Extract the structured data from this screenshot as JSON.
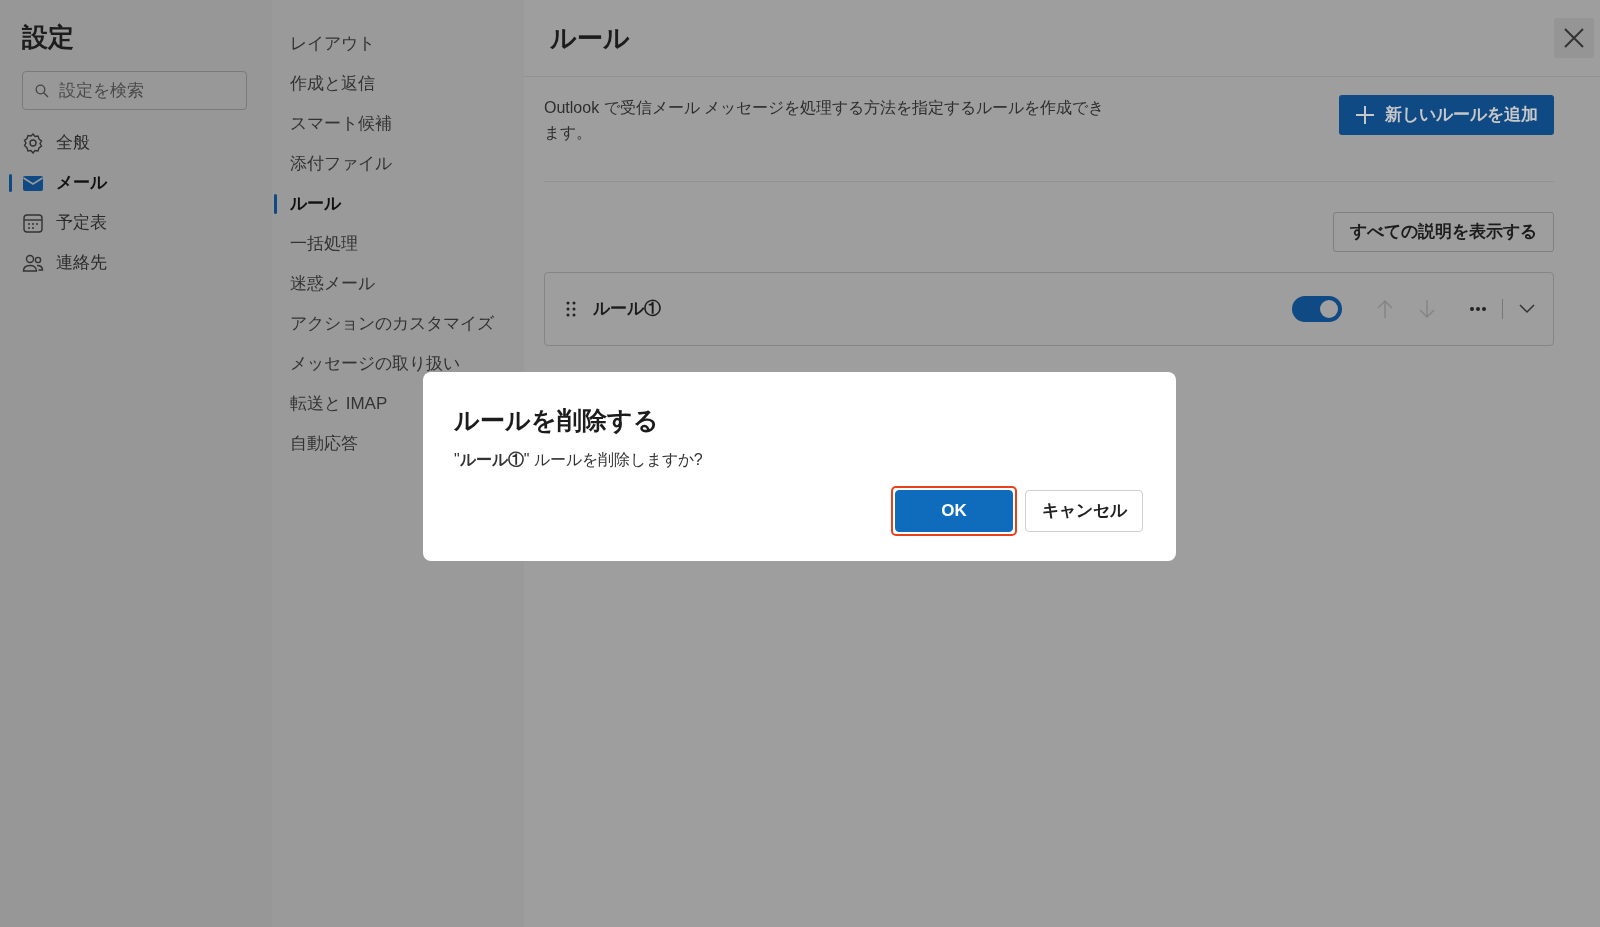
{
  "sidebar": {
    "title": "設定",
    "search": {
      "placeholder": "設定を検索"
    },
    "items": [
      {
        "label": "全般",
        "kind": "gear",
        "selected": false
      },
      {
        "label": "メール",
        "kind": "mail",
        "selected": true
      },
      {
        "label": "予定表",
        "kind": "calendar",
        "selected": false
      },
      {
        "label": "連絡先",
        "kind": "people",
        "selected": false
      }
    ]
  },
  "subnav": {
    "items": [
      {
        "label": "レイアウト",
        "selected": false
      },
      {
        "label": "作成と返信",
        "selected": false
      },
      {
        "label": "スマート候補",
        "selected": false
      },
      {
        "label": "添付ファイル",
        "selected": false
      },
      {
        "label": "ルール",
        "selected": true
      },
      {
        "label": "一括処理",
        "selected": false
      },
      {
        "label": "迷惑メール",
        "selected": false
      },
      {
        "label": "アクションのカスタマイズ",
        "selected": false
      },
      {
        "label": "メッセージの取り扱い",
        "selected": false
      },
      {
        "label": "転送と IMAP",
        "selected": false
      },
      {
        "label": "自動応答",
        "selected": false
      }
    ]
  },
  "main": {
    "title": "ルール",
    "description": "Outlook で受信メール メッセージを処理する方法を指定するルールを作成できます。",
    "add_button": "新しいルールを追加",
    "show_all_button": "すべての説明を表示する",
    "rules": [
      {
        "name": "ルール①",
        "on": true
      }
    ]
  },
  "dialog": {
    "title": "ルールを削除する",
    "message": "\"**ルール①**\" ルールを削除しますか?",
    "buttons": [
      {
        "label": "OK",
        "kind": "primary",
        "highlighted": true
      },
      {
        "label": "キャンセル",
        "kind": "secondary",
        "highlighted": false
      }
    ]
  }
}
